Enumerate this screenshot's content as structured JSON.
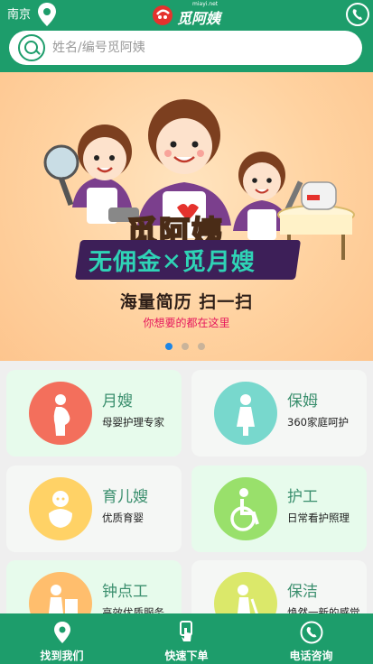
{
  "header": {
    "city": "南京",
    "logo_text": "觅阿姨",
    "logo_sub": "miayi.net",
    "search_placeholder": "姓名/编号觅阿姨"
  },
  "banner": {
    "title": "觅阿姨",
    "slogan": "无佣金✕觅月嫂",
    "tagline": "海量简历 扫一扫",
    "subline": "你想要的都在这里",
    "slide_count": 3,
    "active_slide": 1
  },
  "services": [
    {
      "title": "月嫂",
      "desc": "母婴护理专家",
      "icon": "pregnant-woman-icon",
      "color": "#f36f5c"
    },
    {
      "title": "保姆",
      "desc": "360家庭呵护",
      "icon": "nanny-icon",
      "color": "#78d8cd"
    },
    {
      "title": "育儿嫂",
      "desc": "优质育婴",
      "icon": "baby-icon",
      "color": "#ffd266"
    },
    {
      "title": "护工",
      "desc": "日常看护照理",
      "icon": "wheelchair-icon",
      "color": "#99e06b"
    },
    {
      "title": "钟点工",
      "desc": "高效优质服务",
      "icon": "hourly-worker-icon",
      "color": "#ffbe6d"
    },
    {
      "title": "保洁",
      "desc": "焕然一新的感觉",
      "icon": "cleaning-icon",
      "color": "#dbe86a"
    }
  ],
  "bottom_nav": [
    {
      "label": "找到我们",
      "icon": "location-pin-icon"
    },
    {
      "label": "快速下单",
      "icon": "tap-order-icon"
    },
    {
      "label": "电话咨询",
      "icon": "phone-icon"
    }
  ],
  "colors": {
    "brand": "#1d9d6b",
    "active_dot": "#1e86e6",
    "subline": "#e6185d"
  }
}
